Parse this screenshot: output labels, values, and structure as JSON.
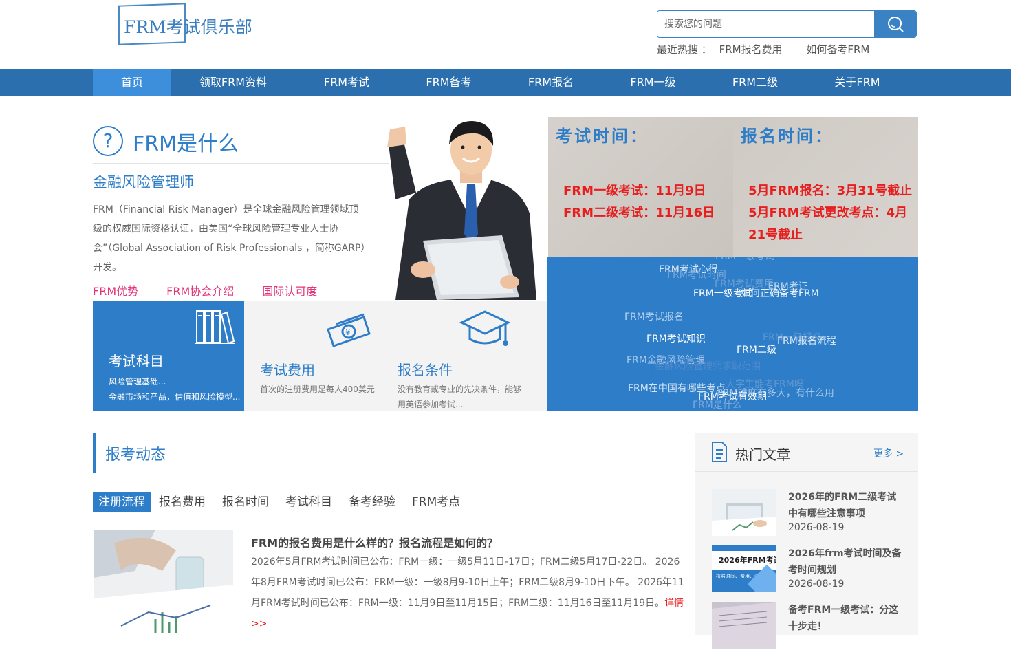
{
  "header": {
    "logo_text": "FRM考试俱乐部",
    "search_placeholder": "搜索您的问题",
    "hot_label": "最近热搜 ：",
    "hot_items": [
      "FRM报名费用",
      "如何备考FRM"
    ]
  },
  "nav": {
    "items": [
      "首页",
      "领取FRM资料",
      "FRM考试",
      "FRM备考",
      "FRM报名",
      "FRM一级",
      "FRM二级",
      "关于FRM"
    ],
    "active": "首页"
  },
  "intro": {
    "title": "FRM是什么",
    "subtitle": "金融风险管理师",
    "text": "FRM（Financial Risk Manager）是全球金融风险管理领域顶级的权威国际资格认证，由美国“全球风险管理专业人士协会”（Global Association of Risk Professionals ，简称GARP）开发。",
    "links": [
      "FRM优势",
      "FRM协会介绍",
      "国际认可度"
    ]
  },
  "exam_time": {
    "title": "考试时间：",
    "lines": [
      "FRM一级考试：11月9日",
      "FRM二级考试：11月16日"
    ]
  },
  "register_time": {
    "title": "报名时间：",
    "lines": [
      "5月FRM报名：3月31号截止",
      "5月FRM考试更改考点：4月21号截止"
    ]
  },
  "tag_cloud": [
    "FRM一级考试",
    "FRM考试心得",
    "FRM考试时间",
    "FRM考试费用",
    "FRM考证",
    "FRM一级考试",
    "如何正确备考FRM",
    "FRM考试报名",
    "FRM一级报名",
    "FRM考试知识",
    "FRM报名流程",
    "FRM二级",
    "FRM金融风险管理",
    "金融风险管理师求职范围",
    "大学生能考FRM吗",
    "FRM在中国有哪些考点",
    "FRM难度有多大，有什么用",
    "FRM考试有效期",
    "FRM是什么"
  ],
  "cards": [
    {
      "title": "考试科目",
      "lines": [
        "风险管理基础...",
        "金融市场和产品，估值和风险模型..."
      ]
    },
    {
      "title": "考试费用",
      "lines": [
        "首次的注册费用是每人400美元"
      ]
    },
    {
      "title": "报名条件",
      "lines": [
        "没有教育或专业的先决条件，能够用英语参加考试..."
      ]
    }
  ],
  "news": {
    "title": "报考动态",
    "tabs": [
      "注册流程",
      "报名费用",
      "报名时间",
      "考试科目",
      "备考经验",
      "FRM考点"
    ],
    "active_tab": "注册流程",
    "article": {
      "title": "FRM的报名费用是什么样的？报名流程是如何的？",
      "text": "2026年5月FRM考试时间已公布：FRM一级：一级5月11日-17日；FRM二级5月17日-22日。 2026年8月FRM考试时间已公布：FRM一级：一级8月9-10日上午；FRM二级8月9-10日下午。 2026年11月FRM考试时间已公布：FRM一级：11月9日至11月15日；FRM二级：11月16日至11月19日。",
      "more": "详情>>"
    }
  },
  "hot_articles": {
    "title": "热门文章",
    "more": "更多 >",
    "items": [
      {
        "title": "2026年的FRM二级考试中有哪些注意事项",
        "date": "2026-08-19",
        "thumb_text": ""
      },
      {
        "title": "2026年frm考试时间及备考时间规划",
        "date": "2026-08-19",
        "thumb_text": "2026年FRM考试",
        "thumb_sub": "报名时间、费用、流程一览"
      },
      {
        "title": "备考FRM一级考试：分这十步走！",
        "date": "",
        "thumb_text": ""
      }
    ]
  },
  "colors": {
    "brand": "#2e7dc8",
    "nav": "#2b6fae",
    "highlight": "#e61e1e",
    "link": "#e4347a"
  }
}
